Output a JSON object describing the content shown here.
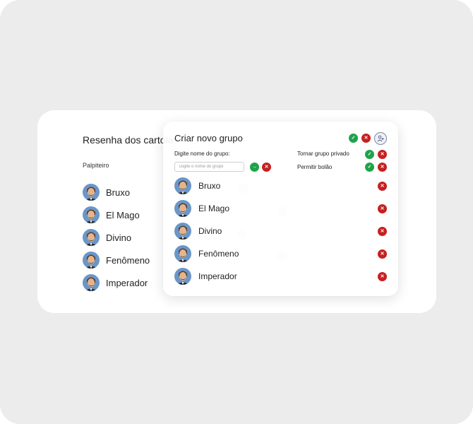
{
  "background": {
    "title": "Resenha dos cartola",
    "column_header": "Palpiteiro",
    "players": [
      "Bruxo",
      "El Mago",
      "Divino",
      "Fenômeno",
      "Imperador"
    ]
  },
  "modal": {
    "title": "Criar novo grupo",
    "name_label": "Digite nome do grupo:",
    "name_placeholder": "Digite o nome do grupo",
    "private_label": "Tornar grupo privado",
    "pool_label": "Permitir bolão",
    "members": [
      {
        "name": "Bruxo"
      },
      {
        "name": "El Mago"
      },
      {
        "name": "Divino"
      },
      {
        "name": "Fenômeno"
      },
      {
        "name": "Imperador"
      }
    ]
  },
  "icons": {
    "confirm": "check-icon",
    "cancel": "x-icon",
    "add_user": "user-plus-icon",
    "submit_name": "arrow-right-icon"
  },
  "colors": {
    "confirm": "#1fa34a",
    "cancel": "#c62020",
    "card": "#ffffff",
    "frame": "#ececec"
  }
}
